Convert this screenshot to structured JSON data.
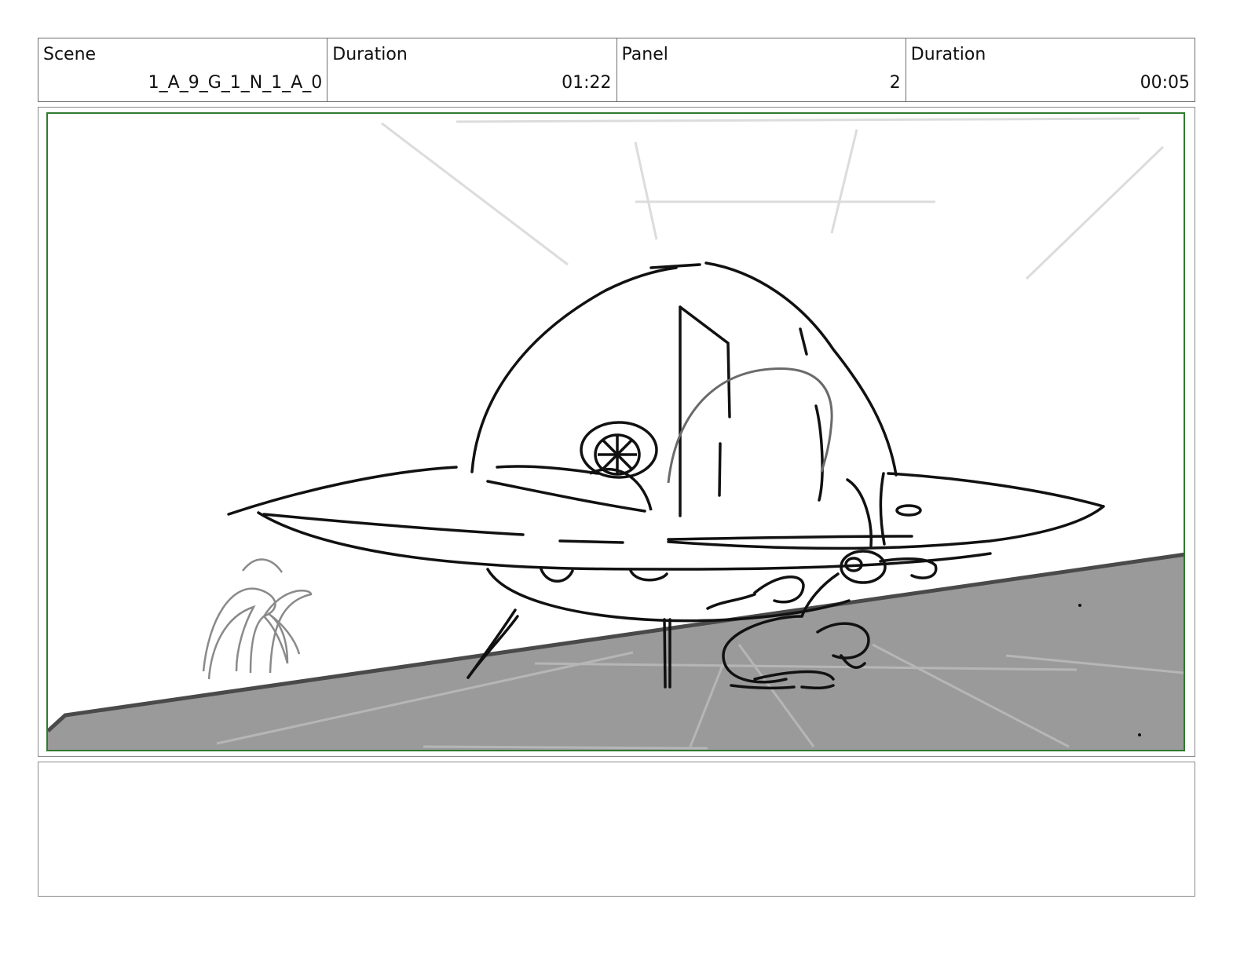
{
  "header": {
    "scene_label": "Scene",
    "scene_value": "1_A_9_G_1_N_1_A_0",
    "duration_label": "Duration",
    "duration_value": "01:22",
    "panel_label": "Panel",
    "panel_value": "2",
    "panel_duration_label": "Duration",
    "panel_duration_value": "00:05"
  },
  "panel": {
    "frame_color": "#2f7a2f",
    "ground_color": "#9a9a9a",
    "line_color": "#111111",
    "guide_color": "#d8d8d8",
    "foliage_color": "#8a8a8a"
  },
  "notes": {
    "text": ""
  }
}
